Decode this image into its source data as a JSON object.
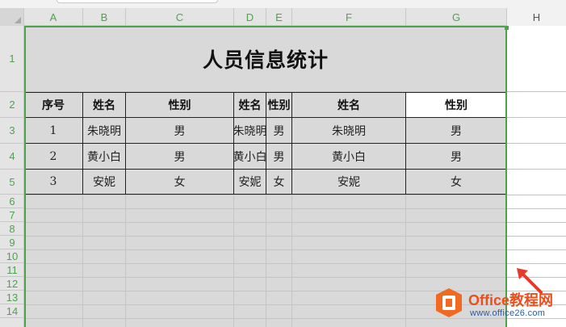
{
  "columns": [
    "A",
    "B",
    "C",
    "D",
    "E",
    "F",
    "G",
    "H"
  ],
  "rows": [
    "1",
    "2",
    "3",
    "4",
    "5",
    "6",
    "7",
    "8",
    "9",
    "10",
    "11",
    "12",
    "13",
    "14"
  ],
  "sheet": {
    "title": "人员信息统计",
    "headers": [
      "序号",
      "姓名",
      "性别",
      "姓名",
      "性别",
      "姓名",
      "性别"
    ],
    "data": [
      [
        "1",
        "朱晓明",
        "男",
        "朱晓明",
        "男",
        "朱晓明",
        "男"
      ],
      [
        "2",
        "黄小白",
        "男",
        "黄小白",
        "男",
        "黄小白",
        "男"
      ],
      [
        "3",
        "安妮",
        "女",
        "安妮",
        "女",
        "安妮",
        "女"
      ]
    ]
  },
  "watermark": {
    "brand_en": "Office",
    "brand_cn": "教程网",
    "url": "www.office26.com"
  },
  "colors": {
    "selection": "#4ea24e",
    "arrow": "#e53b2c",
    "brand": "#e8501e"
  }
}
